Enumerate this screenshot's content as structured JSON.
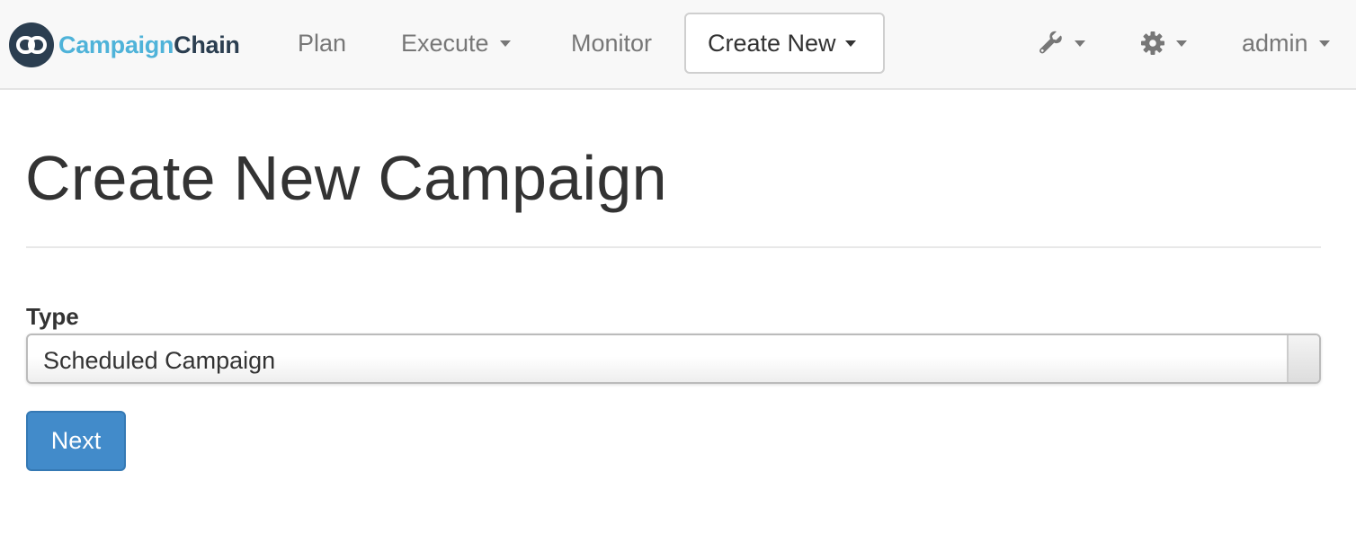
{
  "brand": {
    "name_part1": "Campaign",
    "name_part2": "Chain",
    "logo_icon": "chain-link-icon",
    "colors": {
      "accent": "#4fb3d9",
      "dark": "#2b3e50"
    }
  },
  "nav": {
    "items": [
      {
        "label": "Plan",
        "has_dropdown": false
      },
      {
        "label": "Execute",
        "has_dropdown": true
      },
      {
        "label": "Monitor",
        "has_dropdown": false
      },
      {
        "label": "Create New",
        "has_dropdown": true,
        "active": true
      }
    ],
    "right": [
      {
        "icon": "wrench-icon",
        "has_dropdown": true
      },
      {
        "icon": "gear-icon",
        "has_dropdown": true
      },
      {
        "label": "admin",
        "has_dropdown": true
      }
    ]
  },
  "page": {
    "title": "Create New Campaign"
  },
  "form": {
    "type_label": "Type",
    "type_value": "Scheduled Campaign",
    "next_label": "Next",
    "button_color": "#428bca"
  }
}
